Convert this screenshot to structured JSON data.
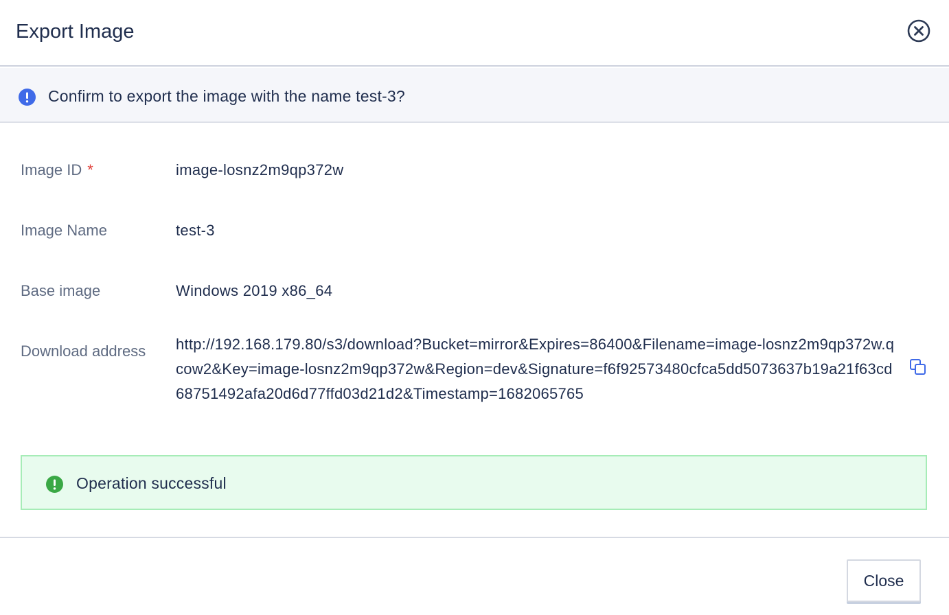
{
  "dialog": {
    "title": "Export Image",
    "close_icon": "close-circle-icon"
  },
  "confirm": {
    "icon": "info-icon",
    "text": "Confirm to export the image with the name test-3?",
    "icon_color": "#3f6ae8"
  },
  "fields": {
    "image_id": {
      "label": "Image ID",
      "required_mark": "*",
      "value": "image-losnz2m9qp372w"
    },
    "image_name": {
      "label": "Image Name",
      "value": "test-3"
    },
    "base_image": {
      "label": "Base image",
      "value": "Windows 2019 x86_64"
    },
    "download_address": {
      "label": "Download address",
      "value": "http://192.168.179.80/s3/download?Bucket=mirror&Expires=86400&Filename=image-losnz2m9qp372w.qcow2&Key=image-losnz2m9qp372w&Region=dev&Signature=f6f92573480cfca5dd5073637b19a21f63cd68751492afa20d6d77ffd03d21d2&Timestamp=1682065765",
      "copy_icon": "copy-icon"
    }
  },
  "status": {
    "icon": "success-icon",
    "text": "Operation successful",
    "color": "#3aa845",
    "background": "#e8fbee"
  },
  "footer": {
    "close_label": "Close"
  }
}
